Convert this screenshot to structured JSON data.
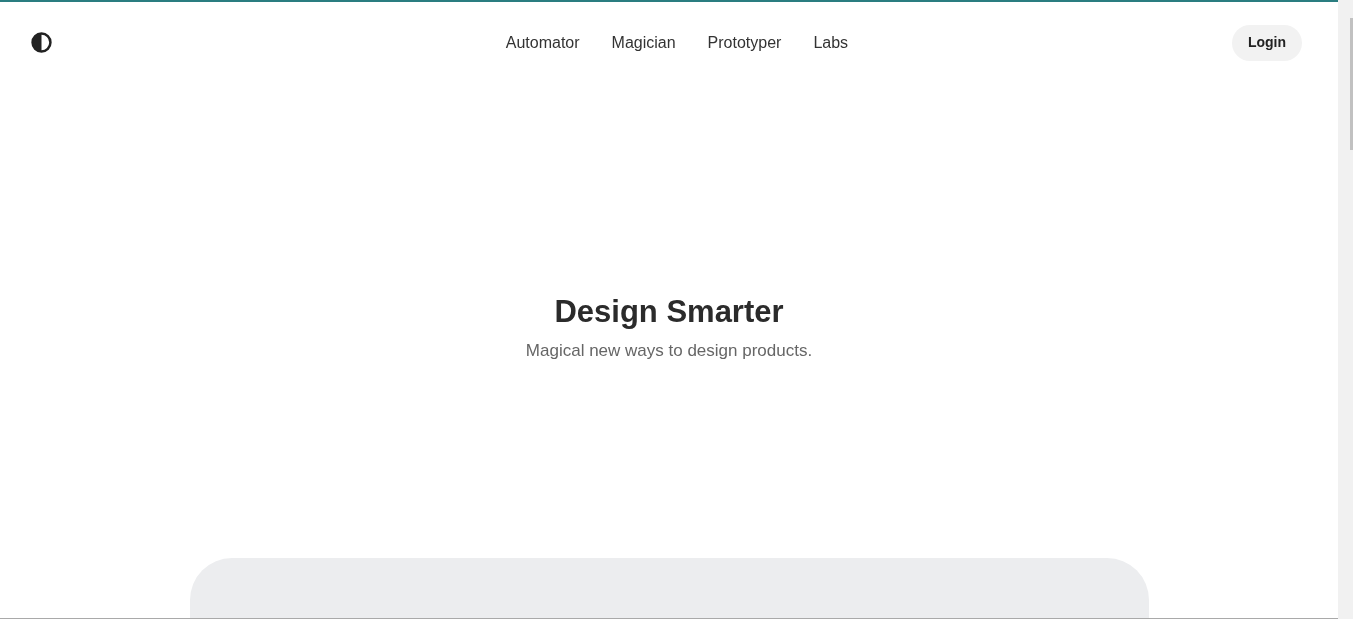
{
  "nav": {
    "links": [
      {
        "label": "Automator"
      },
      {
        "label": "Magician"
      },
      {
        "label": "Prototyper"
      },
      {
        "label": "Labs"
      }
    ],
    "login": "Login"
  },
  "hero": {
    "title": "Design Smarter",
    "subtitle": "Magical new ways to design products."
  }
}
